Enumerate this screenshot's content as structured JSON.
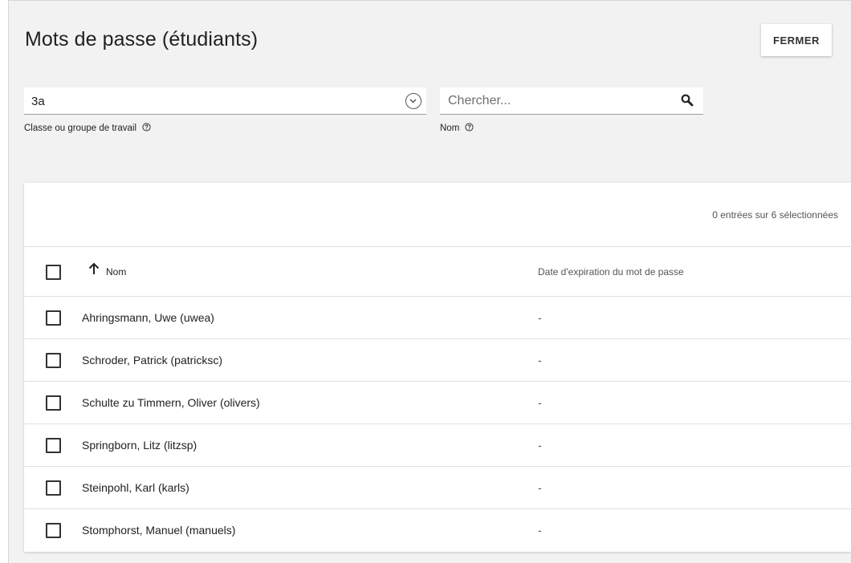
{
  "page": {
    "title": "Mots de passe (étudiants)",
    "close_label": "FERMER"
  },
  "filters": {
    "class": {
      "value": "3a",
      "label": "Classe ou groupe de travail",
      "icon": "chevron-down-circle-icon"
    },
    "search": {
      "placeholder": "Chercher...",
      "value": "",
      "label": "Nom",
      "icon": "search-icon"
    },
    "help_icon": "help-circle-icon"
  },
  "table": {
    "selection_info": "0 entrées sur 6 sélectionnées",
    "columns": {
      "name": "Nom",
      "expiry": "Date d'expiration du mot de passe",
      "sort_icon": "arrow-up-icon"
    },
    "rows": [
      {
        "name": "Ahringsmann, Uwe (uwea)",
        "expiry": "-",
        "checked": false
      },
      {
        "name": "Schroder, Patrick (patricksc)",
        "expiry": "-",
        "checked": false
      },
      {
        "name": "Schulte zu Timmern, Oliver (olivers)",
        "expiry": "-",
        "checked": false
      },
      {
        "name": "Springborn, Litz (litzsp)",
        "expiry": "-",
        "checked": false
      },
      {
        "name": "Steinpohl, Karl (karls)",
        "expiry": "-",
        "checked": false
      },
      {
        "name": "Stomphorst, Manuel (manuels)",
        "expiry": "-",
        "checked": false
      }
    ]
  },
  "colors": {
    "panel_background": "#f2f2f2",
    "card_background": "#ffffff",
    "text": "#212121",
    "muted_text": "#555555"
  }
}
